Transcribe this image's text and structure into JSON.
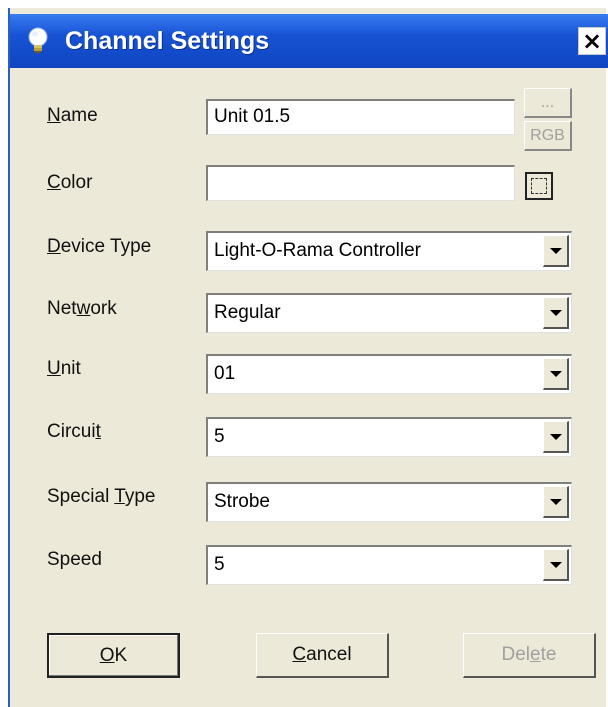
{
  "window": {
    "title": "Channel Settings",
    "close_label": "×"
  },
  "fields": {
    "name": {
      "label_prefix": "",
      "label_mnemonic": "N",
      "label_rest": "ame",
      "value": "Unit 01.5"
    },
    "color": {
      "label_prefix": "",
      "label_mnemonic": "C",
      "label_rest": "olor",
      "value": ""
    },
    "device_type": {
      "label_prefix": "",
      "label_mnemonic": "D",
      "label_rest": "evice Type",
      "value": "Light-O-Rama Controller"
    },
    "network": {
      "label_prefix": "Net",
      "label_mnemonic": "w",
      "label_rest": "ork",
      "value": "Regular"
    },
    "unit": {
      "label_prefix": "",
      "label_mnemonic": "U",
      "label_rest": "nit",
      "value": "01"
    },
    "circuit": {
      "label_prefix": "Circui",
      "label_mnemonic": "t",
      "label_rest": "",
      "value": "5"
    },
    "special_type": {
      "label_prefix": "Special ",
      "label_mnemonic": "T",
      "label_rest": "ype",
      "value": "Strobe"
    },
    "speed": {
      "label_prefix": "Speed",
      "label_mnemonic": "",
      "label_rest": "",
      "value": "5"
    }
  },
  "side_buttons": {
    "browse_label": "...",
    "rgb_label": "RGB"
  },
  "buttons": {
    "ok": {
      "mnemonic": "O",
      "rest": "K"
    },
    "cancel": {
      "mnemonic": "C",
      "rest": "ancel"
    },
    "delete": {
      "prefix": "Del",
      "mnemonic": "e",
      "rest": "te"
    }
  },
  "colors": {
    "titlebar": "#1653d4",
    "dialog_bg": "#ece9d8",
    "disabled_text": "#a0a0a0"
  },
  "icons": {
    "title": "lightbulb-icon",
    "combo_arrow": "chevron-down-icon",
    "color_picker": "color-picker-icon"
  }
}
